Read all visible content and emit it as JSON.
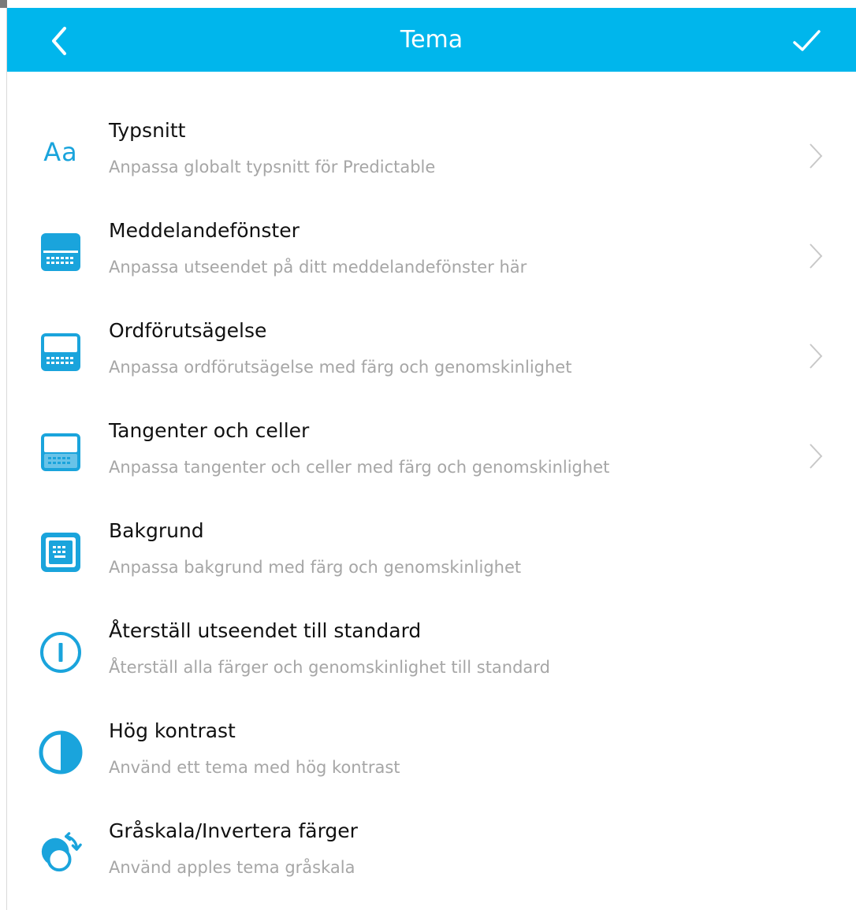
{
  "header": {
    "title": "Tema",
    "back_icon": "chevron-left-icon",
    "done_icon": "checkmark-icon"
  },
  "colors": {
    "accent": "#00b6ec",
    "icon_blue": "#1aa4dc",
    "subtitle_gray": "#a6a6a6",
    "chevron_gray": "#c8c8c8"
  },
  "items": [
    {
      "icon": "font-aa-icon",
      "icon_text": "Aa",
      "label": "Typsnitt",
      "subtitle": "Anpassa globalt typsnitt för Predictable",
      "has_chevron": true
    },
    {
      "icon": "message-window-icon",
      "label": "Meddelandefönster",
      "subtitle": "Anpassa utseendet på ditt meddelandefönster här",
      "has_chevron": true
    },
    {
      "icon": "word-prediction-icon",
      "label": "Ordförutsägelse",
      "subtitle": "Anpassa ordförutsägelse med färg och genomskinlighet",
      "has_chevron": true
    },
    {
      "icon": "keys-cells-icon",
      "label": "Tangenter och celler",
      "subtitle": "Anpassa tangenter och celler med färg och genomskinlighet",
      "has_chevron": true
    },
    {
      "icon": "background-icon",
      "label": "Bakgrund",
      "subtitle": "Anpassa bakgrund med färg och genomskinlighet",
      "has_chevron": false
    },
    {
      "icon": "reset-icon",
      "label": "Återställ utseendet till standard",
      "subtitle": "Återställ alla färger och genomskinlighet till standard",
      "has_chevron": false
    },
    {
      "icon": "high-contrast-icon",
      "label": "Hög kontrast",
      "subtitle": "Använd ett tema med hög kontrast",
      "has_chevron": false
    },
    {
      "icon": "grayscale-invert-icon",
      "label": "Gråskala/Invertera färger",
      "subtitle": "Använd apples tema gråskala",
      "has_chevron": false
    }
  ]
}
